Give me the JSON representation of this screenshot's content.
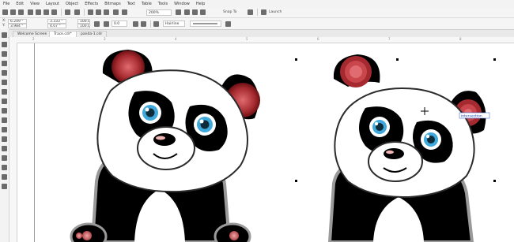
{
  "menu": {
    "items": [
      "File",
      "Edit",
      "View",
      "Layout",
      "Object",
      "Effects",
      "Bitmaps",
      "Text",
      "Table",
      "Tools",
      "Window",
      "Help"
    ]
  },
  "standard_bar": {
    "zoom": "200%",
    "snap_to": "Snap To",
    "launch": "Launch"
  },
  "property_bar": {
    "x_label": "X:",
    "x_value": "6.249 \"",
    "y_label": "Y:",
    "y_value": "3.984 \"",
    "w_value": "3.333 \"",
    "h_value": "4.07 \"",
    "scale_w": "100.0",
    "scale_h": "100.0",
    "rotation": "0.0",
    "outline_width": "Hairline"
  },
  "document_tabs": [
    {
      "label": "Welcome Screen",
      "active": false
    },
    {
      "label": "Trace.cdr*",
      "active": true
    },
    {
      "label": "panda-1.cdr",
      "active": false
    }
  ],
  "ruler": {
    "labels": [
      "2",
      "3",
      "4",
      "5",
      "6",
      "7",
      "8"
    ]
  },
  "canvas": {
    "tooltip": "intersection",
    "colors": {
      "ear": "#8a1f24",
      "ear_highlight": "#e06b70",
      "eye": "#3fa9dc",
      "nose_highlight": "#f3b6b6"
    }
  }
}
